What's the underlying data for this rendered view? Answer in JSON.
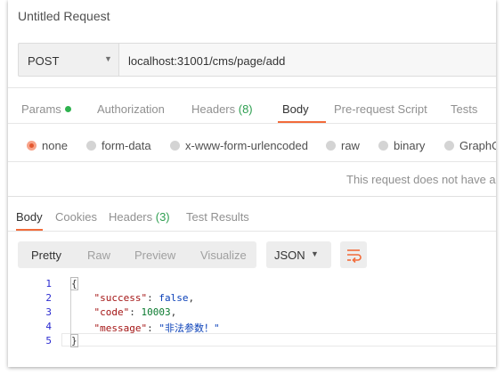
{
  "window": {
    "title": "Untitled Request"
  },
  "request": {
    "method": "POST",
    "url": "localhost:31001/cms/page/add"
  },
  "request_tabs": [
    {
      "label": "Params",
      "count": "",
      "active": false
    },
    {
      "label": "Authorization",
      "count": "",
      "active": false
    },
    {
      "label": "Headers ",
      "count": "(8)",
      "active": false
    },
    {
      "label": "Body",
      "count": "",
      "active": true
    },
    {
      "label": "Pre-request Script",
      "count": "",
      "active": false
    },
    {
      "label": "Tests",
      "count": "",
      "active": false
    }
  ],
  "body_types": [
    {
      "label": "none",
      "selected": true
    },
    {
      "label": "form-data",
      "selected": false
    },
    {
      "label": "x-www-form-urlencoded",
      "selected": false
    },
    {
      "label": "raw",
      "selected": false
    },
    {
      "label": "binary",
      "selected": false
    },
    {
      "label": "GraphQ",
      "selected": false
    }
  ],
  "body_note": "This request does not have a b",
  "response_tabs": [
    {
      "label": "Body",
      "count": "",
      "active": true
    },
    {
      "label": "Cookies",
      "count": "",
      "active": false
    },
    {
      "label": "Headers ",
      "count": "(3)",
      "active": false
    },
    {
      "label": "Test Results",
      "count": "",
      "active": false
    }
  ],
  "view_modes": [
    "Pretty",
    "Raw",
    "Preview",
    "Visualize"
  ],
  "active_view": "Pretty",
  "format": "JSON",
  "code": {
    "line_numbers": [
      "1",
      "2",
      "3",
      "4",
      "5"
    ],
    "open_brace": "{",
    "success_key": "\"success\"",
    "success_val": "false",
    "code_key": "\"code\"",
    "code_val": "10003",
    "message_key": "\"message\"",
    "message_val": "\"非法参数！\"",
    "close_brace": "}"
  },
  "colors": {
    "accent": "#f26b3a",
    "count_green": "#2e9f50",
    "json_key": "#a41515",
    "json_value": "#0a40b8"
  },
  "icons": {
    "params_status": "green-dot-icon",
    "method_dropdown": "chevron-down-icon",
    "format_dropdown": "chevron-down-icon",
    "wrap": "wrap-lines-icon"
  }
}
